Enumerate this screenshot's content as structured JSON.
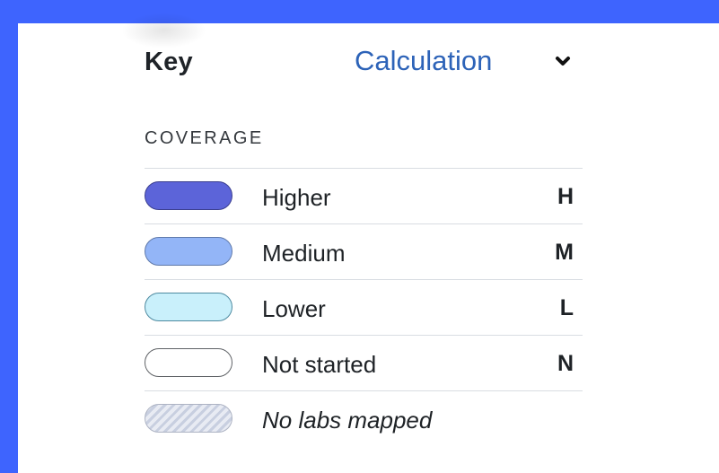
{
  "key": {
    "title": "Key",
    "calculation_link": "Calculation",
    "toggle_icon": "chevron-down-icon"
  },
  "coverage": {
    "section_label": "COVERAGE",
    "items": [
      {
        "label": "Higher",
        "code": "H",
        "fill": "#5c64d9",
        "border": "#3b3f8f",
        "style": "solid"
      },
      {
        "label": "Medium",
        "code": "M",
        "fill": "#93b5f7",
        "border": "#5f79aa",
        "style": "solid"
      },
      {
        "label": "Lower",
        "code": "L",
        "fill": "#c9f0fb",
        "border": "#4e8aa0",
        "style": "solid"
      },
      {
        "label": "Not started",
        "code": "N",
        "fill": "#ffffff",
        "border": "#5f6266",
        "style": "solid"
      },
      {
        "label": "No labs mapped",
        "code": "",
        "fill": "#d9deeb",
        "border": "#adb3c3",
        "style": "hatched"
      }
    ]
  },
  "colors": {
    "page_background": "#3e64fe",
    "panel_background": "#ffffff",
    "link": "#2d63b8",
    "divider": "#d9dde2"
  }
}
